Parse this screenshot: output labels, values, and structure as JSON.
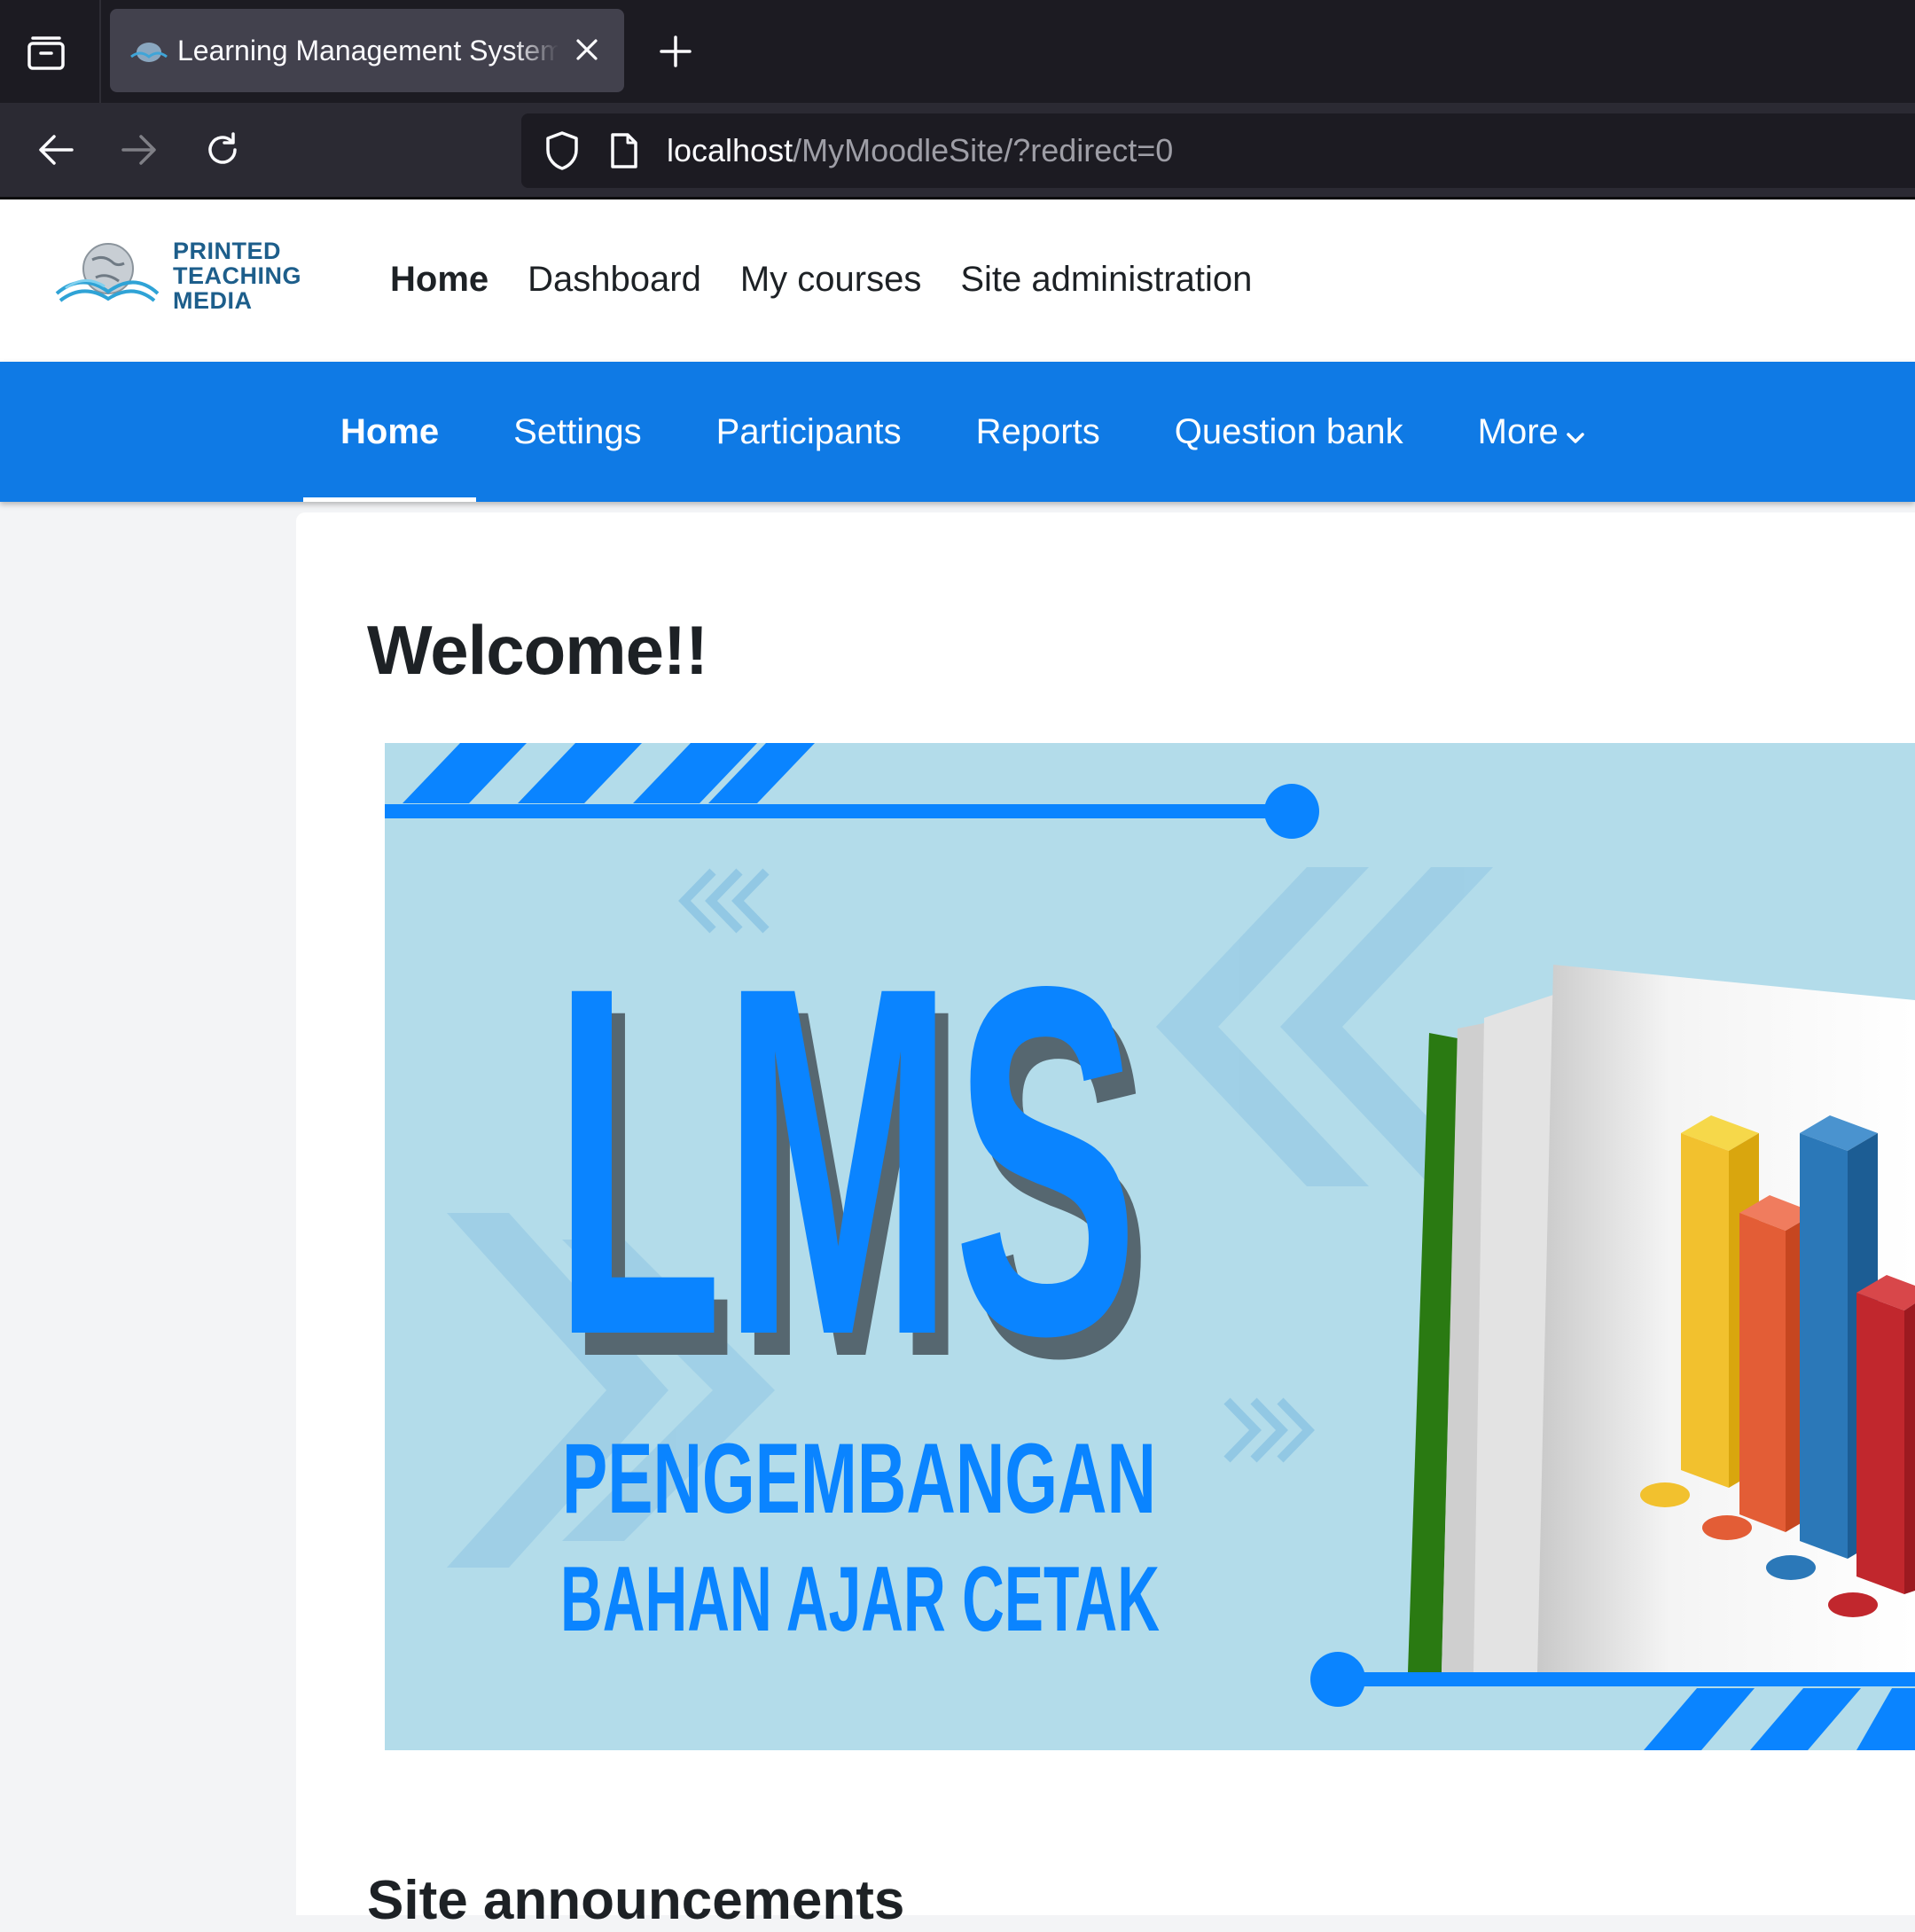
{
  "browser": {
    "tab_title": "Learning Management System o",
    "url_host": "localhost",
    "url_path": "/MyMoodleSite/?redirect=0"
  },
  "site": {
    "logo_lines": [
      "PRINTED",
      "TEACHING",
      "MEDIA"
    ],
    "primary_nav": [
      "Home",
      "Dashboard",
      "My courses",
      "Site administration"
    ],
    "secondary_nav": [
      "Home",
      "Settings",
      "Participants",
      "Reports",
      "Question bank",
      "More"
    ]
  },
  "main": {
    "title": "Welcome!!",
    "banner": {
      "headline": "LMS",
      "line1": "PENGEMBANGAN",
      "line2": "BAHAN AJAR  CETAK"
    },
    "section_title": "Site announcements"
  },
  "colors": {
    "accent": "#0f7ae5",
    "banner_blue": "#0a84ff",
    "banner_bg": "#b3dcea"
  }
}
